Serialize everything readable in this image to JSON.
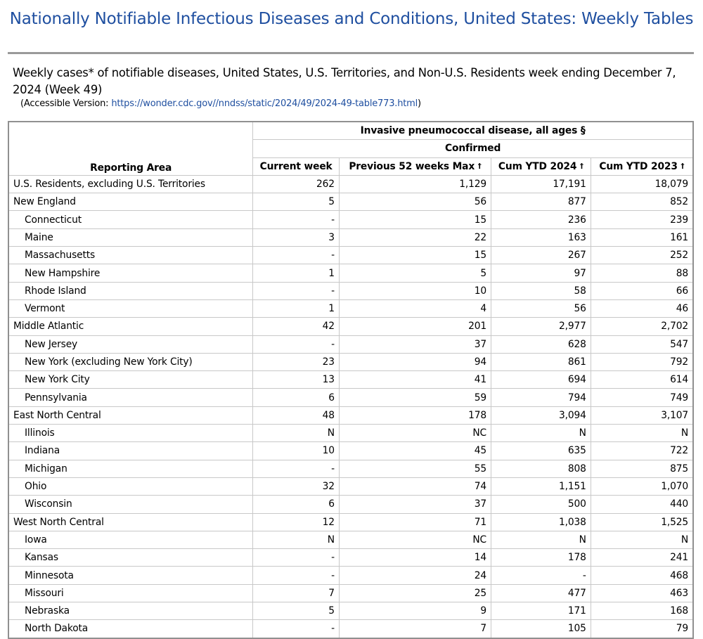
{
  "page_title": "Nationally Notifiable Infectious Diseases and Conditions, United States: Weekly Tables",
  "caption": "Weekly cases* of notifiable diseases, United States, U.S. Territories, and Non-U.S. Residents week ending December 7, 2024 (Week 49)",
  "accessible": {
    "label": "(Accessible Version:",
    "link_text": "https://wonder.cdc.gov//nndss/static/2024/49/2024-49-table773.html",
    "suffix": ")"
  },
  "table": {
    "disease_header": "Invasive pneumococcal disease, all ages §",
    "status_header": "Confirmed",
    "area_header": "Reporting Area",
    "columns": [
      {
        "label": "Current week",
        "dagger": ""
      },
      {
        "label": "Previous 52 weeks Max",
        "dagger": "†"
      },
      {
        "label": "Cum YTD 2024",
        "dagger": "†"
      },
      {
        "label": "Cum YTD 2023",
        "dagger": "†"
      }
    ],
    "rows": [
      {
        "area": "U.S. Residents, excluding U.S. Territories",
        "sub": false,
        "values": [
          "262",
          "1,129",
          "17,191",
          "18,079"
        ]
      },
      {
        "area": "New England",
        "sub": false,
        "values": [
          "5",
          "56",
          "877",
          "852"
        ]
      },
      {
        "area": "Connecticut",
        "sub": true,
        "values": [
          "-",
          "15",
          "236",
          "239"
        ]
      },
      {
        "area": "Maine",
        "sub": true,
        "values": [
          "3",
          "22",
          "163",
          "161"
        ]
      },
      {
        "area": "Massachusetts",
        "sub": true,
        "values": [
          "-",
          "15",
          "267",
          "252"
        ]
      },
      {
        "area": "New Hampshire",
        "sub": true,
        "values": [
          "1",
          "5",
          "97",
          "88"
        ]
      },
      {
        "area": "Rhode Island",
        "sub": true,
        "values": [
          "-",
          "10",
          "58",
          "66"
        ]
      },
      {
        "area": "Vermont",
        "sub": true,
        "values": [
          "1",
          "4",
          "56",
          "46"
        ]
      },
      {
        "area": "Middle Atlantic",
        "sub": false,
        "values": [
          "42",
          "201",
          "2,977",
          "2,702"
        ]
      },
      {
        "area": "New Jersey",
        "sub": true,
        "values": [
          "-",
          "37",
          "628",
          "547"
        ]
      },
      {
        "area": "New York (excluding New York City)",
        "sub": true,
        "values": [
          "23",
          "94",
          "861",
          "792"
        ]
      },
      {
        "area": "New York City",
        "sub": true,
        "values": [
          "13",
          "41",
          "694",
          "614"
        ]
      },
      {
        "area": "Pennsylvania",
        "sub": true,
        "values": [
          "6",
          "59",
          "794",
          "749"
        ]
      },
      {
        "area": "East North Central",
        "sub": false,
        "values": [
          "48",
          "178",
          "3,094",
          "3,107"
        ]
      },
      {
        "area": "Illinois",
        "sub": true,
        "values": [
          "N",
          "NC",
          "N",
          "N"
        ]
      },
      {
        "area": "Indiana",
        "sub": true,
        "values": [
          "10",
          "45",
          "635",
          "722"
        ]
      },
      {
        "area": "Michigan",
        "sub": true,
        "values": [
          "-",
          "55",
          "808",
          "875"
        ]
      },
      {
        "area": "Ohio",
        "sub": true,
        "values": [
          "32",
          "74",
          "1,151",
          "1,070"
        ]
      },
      {
        "area": "Wisconsin",
        "sub": true,
        "values": [
          "6",
          "37",
          "500",
          "440"
        ]
      },
      {
        "area": "West North Central",
        "sub": false,
        "values": [
          "12",
          "71",
          "1,038",
          "1,525"
        ]
      },
      {
        "area": "Iowa",
        "sub": true,
        "values": [
          "N",
          "NC",
          "N",
          "N"
        ]
      },
      {
        "area": "Kansas",
        "sub": true,
        "values": [
          "-",
          "14",
          "178",
          "241"
        ]
      },
      {
        "area": "Minnesota",
        "sub": true,
        "values": [
          "-",
          "24",
          "-",
          "468"
        ]
      },
      {
        "area": "Missouri",
        "sub": true,
        "values": [
          "7",
          "25",
          "477",
          "463"
        ]
      },
      {
        "area": "Nebraska",
        "sub": true,
        "values": [
          "5",
          "9",
          "171",
          "168"
        ]
      },
      {
        "area": "North Dakota",
        "sub": true,
        "values": [
          "-",
          "7",
          "105",
          "79"
        ]
      }
    ]
  }
}
